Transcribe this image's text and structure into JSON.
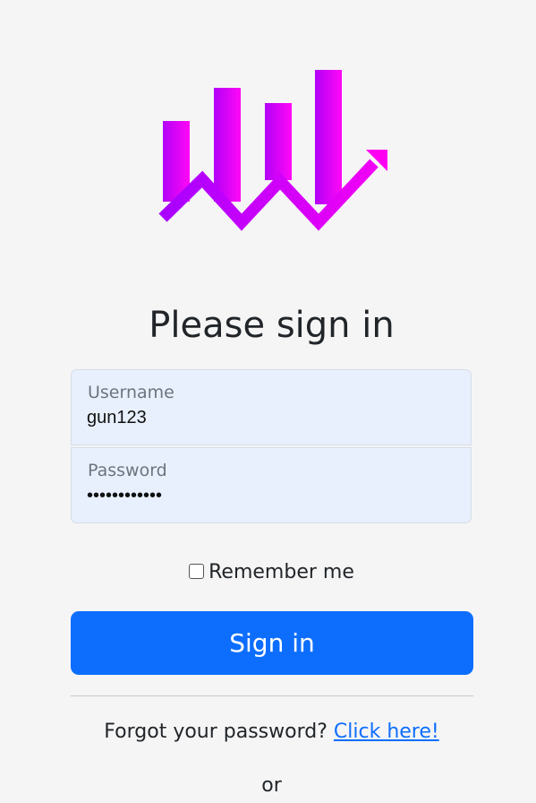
{
  "brand": {
    "gradient_start": "#a600ff",
    "gradient_end": "#ff00ff"
  },
  "heading": "Please sign in",
  "form": {
    "username": {
      "label": "Username",
      "value": "gun123"
    },
    "password": {
      "label": "Password",
      "value": "••••••••••••"
    },
    "remember_label": "Remember me",
    "submit_label": "Sign in",
    "submit_color": "#0d6efd"
  },
  "forgot": {
    "prompt": "Forgot your password?",
    "link": "Click here!"
  },
  "alt_separator": "or"
}
